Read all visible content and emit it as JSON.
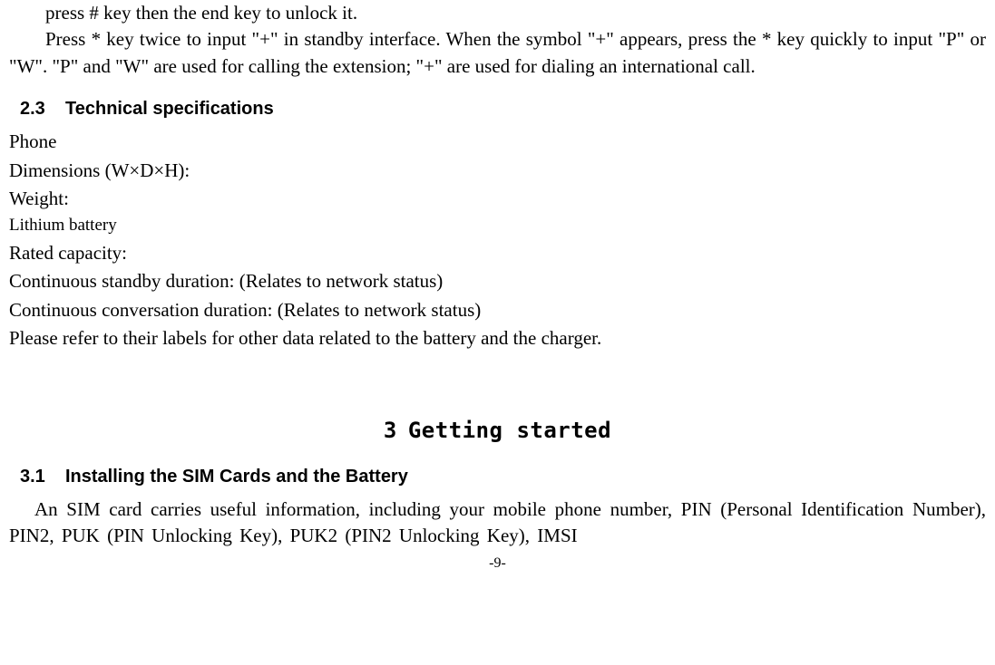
{
  "top_para_line1": "press # key then the end key to unlock it.",
  "top_para_line2": "Press * key twice to input \"+\" in standby interface. When the symbol \"+\" appears, press the * key quickly to input \"P\" or \"W\". \"P\" and \"W\" are used for calling the extension; \"+\" are used for dialing an international call.",
  "section23": {
    "num": "2.3",
    "title": "Technical specifications"
  },
  "specs": {
    "phone_label": "Phone",
    "dimensions": "Dimensions (W×D×H):",
    "weight": "Weight:",
    "battery_label": "Lithium battery",
    "capacity": "Rated capacity:",
    "standby": "Continuous standby duration: (Relates to network status)",
    "talk": "Continuous conversation duration: (Relates to network status)",
    "refer": "Please refer to their labels for other data related to the battery and the charger."
  },
  "chapter3": {
    "num": "3",
    "title": "Getting started"
  },
  "section31": {
    "num": "3.1",
    "title": "Installing the SIM Cards and the Battery"
  },
  "sim_para": "An SIM card carries useful information, including your mobile phone number, PIN (Personal Identification Number), PIN2, PUK (PIN Unlocking Key), PUK2 (PIN2 Unlocking Key), IMSI",
  "page_num": "-9-"
}
